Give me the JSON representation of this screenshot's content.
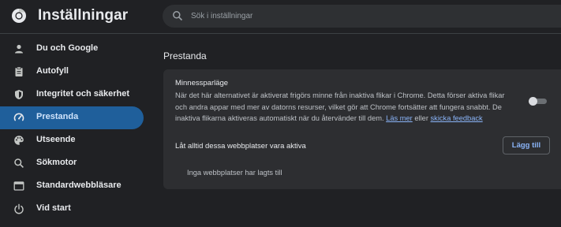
{
  "header": {
    "app_title": "Inställningar",
    "logo_icon": "chrome-icon",
    "search": {
      "placeholder": "Sök i inställningar",
      "value": "",
      "icon": "search-icon"
    }
  },
  "sidebar": {
    "items": [
      {
        "label": "Du och Google",
        "icon": "person-icon",
        "active": false
      },
      {
        "label": "Autofyll",
        "icon": "clipboard-icon",
        "active": false
      },
      {
        "label": "Integritet och säkerhet",
        "icon": "shield-icon",
        "active": false
      },
      {
        "label": "Prestanda",
        "icon": "speedometer-icon",
        "active": true
      },
      {
        "label": "Utseende",
        "icon": "palette-icon",
        "active": false
      },
      {
        "label": "Sökmotor",
        "icon": "search-icon",
        "active": false
      },
      {
        "label": "Standardwebbläsare",
        "icon": "browser-icon",
        "active": false
      },
      {
        "label": "Vid start",
        "icon": "power-icon",
        "active": false
      }
    ]
  },
  "main": {
    "section_title": "Prestanda",
    "memory_saver": {
      "title": "Minnessparläge",
      "description": "När det här alternativet är aktiverat frigörs minne från inaktiva flikar i Chrome. Detta förser aktiva flikar och andra appar med mer av datorns resurser, vilket gör att Chrome fortsätter att fungera snabbt. De inaktiva flikarna aktiveras automatiskt när du återvänder till dem.",
      "learn_more": "Läs mer",
      "or_text": "eller",
      "feedback": "skicka feedback",
      "enabled": false
    },
    "always_active": {
      "label": "Låt alltid dessa webbplatser vara aktiva",
      "add_button": "Lägg till",
      "empty_text": "Inga webbplatser har lagts till"
    }
  },
  "colors": {
    "background": "#202124",
    "card": "#2d2e31",
    "accent": "#8ab4f8",
    "active_nav": "#1f5f9b"
  }
}
